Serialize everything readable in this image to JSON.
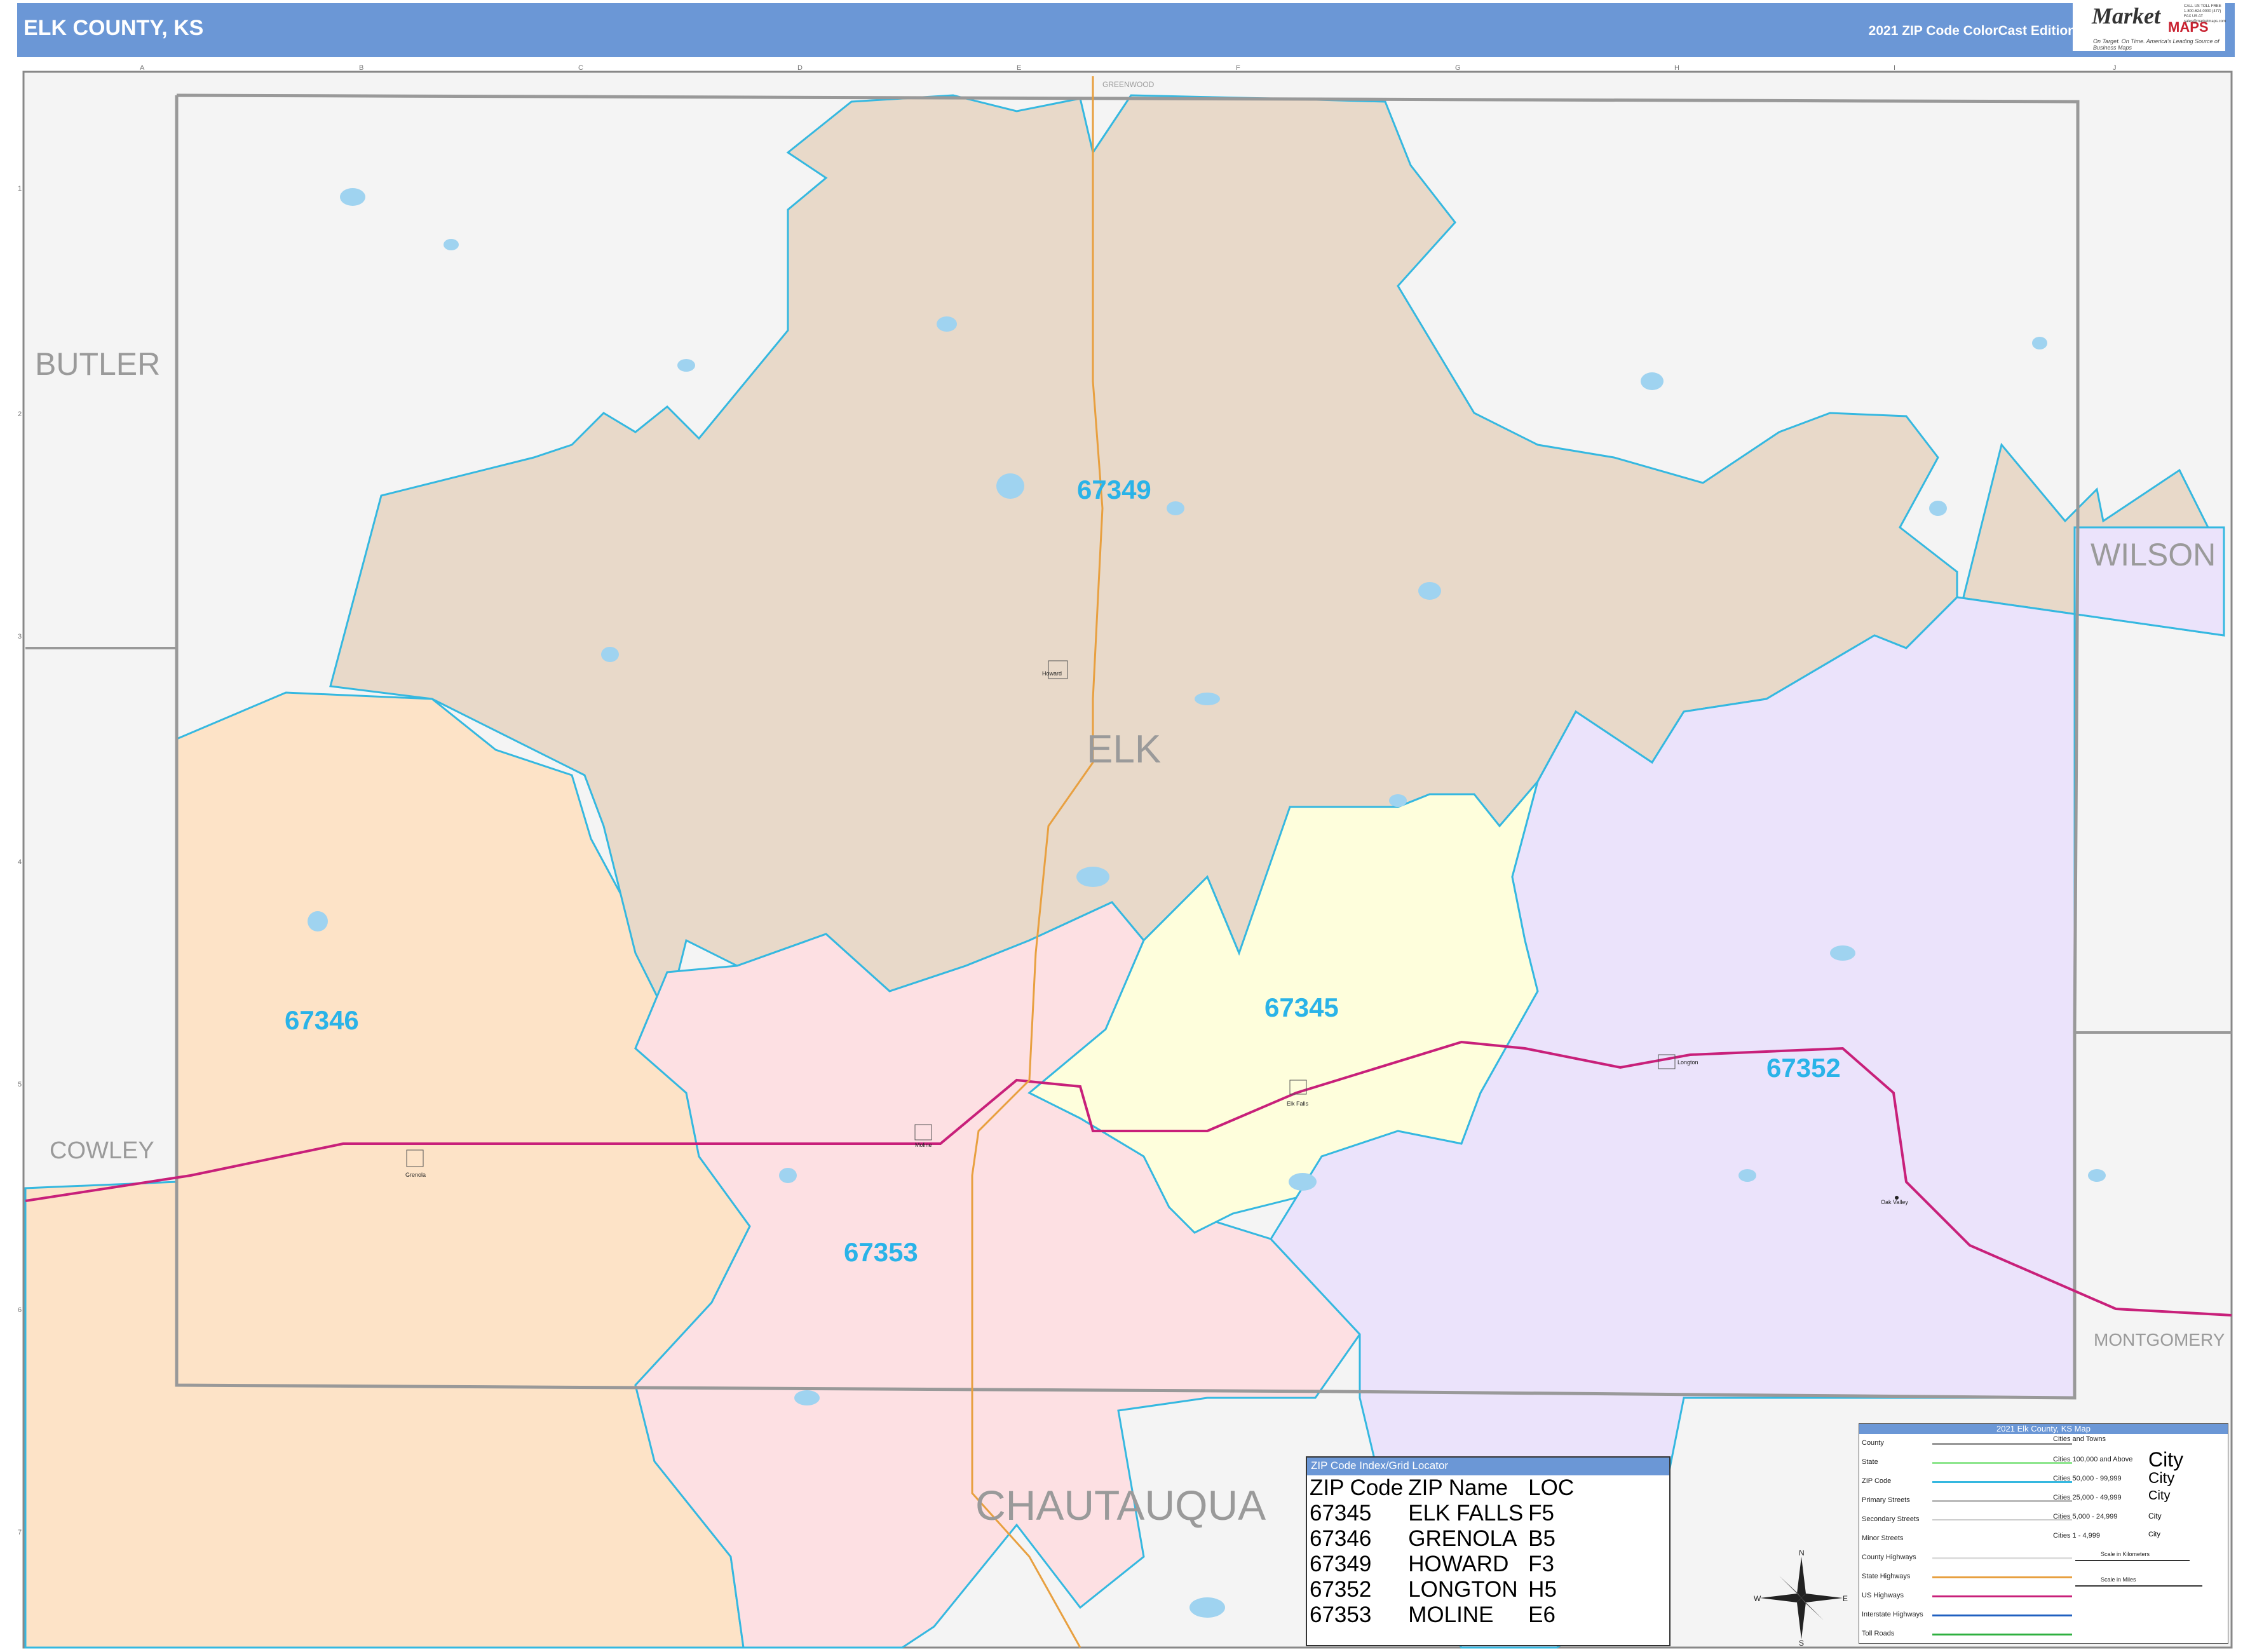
{
  "header": {
    "title": "ELK COUNTY, KS",
    "edition": "2021 ZIP Code ColorCast Edition"
  },
  "logo": {
    "main": "Market",
    "sub": "MAPS",
    "tagline": "On Target. On Time. America's Leading Source of Business Maps",
    "contact": "CALL US TOLL FREE 1-800-624-0000 (477) FAX US AT sales@marketmaps.com"
  },
  "grid": {
    "columns": [
      "A",
      "B",
      "C",
      "D",
      "E",
      "F",
      "G",
      "H",
      "I",
      "J"
    ],
    "rows": [
      "1",
      "2",
      "3",
      "4",
      "5",
      "6",
      "7"
    ]
  },
  "counties": {
    "butler": "BUTLER",
    "wilson": "WILSON",
    "cowley": "COWLEY",
    "montgomery": "MONTGOMERY",
    "chautauqua": "CHAUTAUQUA",
    "elk": "ELK",
    "greenwood": "GREENWOOD"
  },
  "zips": {
    "z67349": "67349",
    "z67346": "67346",
    "z67345": "67345",
    "z67352": "67352",
    "z67353": "67353"
  },
  "zip_colors": {
    "67349": "#e8d9c9",
    "67346": "#fde3c7",
    "67345": "#fefedc",
    "67352": "#ebe3fb",
    "67353": "#fde0e3"
  },
  "cities": {
    "howard": "Howard",
    "moline": "Moline",
    "grenola": "Grenola",
    "elk_falls": "Elk Falls",
    "longton": "Longton",
    "oak_valley": "Oak Valley"
  },
  "zip_index": {
    "title": "ZIP Code Index/Grid Locator",
    "headers": [
      "ZIP Code",
      "ZIP Name",
      "LOC"
    ],
    "rows": [
      [
        "67345",
        "ELK FALLS",
        "F5"
      ],
      [
        "67346",
        "GRENOLA",
        "B5"
      ],
      [
        "67349",
        "HOWARD",
        "F3"
      ],
      [
        "67352",
        "LONGTON",
        "H5"
      ],
      [
        "67353",
        "MOLINE",
        "E6"
      ]
    ]
  },
  "legend": {
    "title": "2021 Elk County, KS Map",
    "items": [
      "County",
      "State",
      "ZIP Code",
      "Primary Streets",
      "Secondary Streets",
      "Minor Streets",
      "County Highways",
      "State Highways",
      "US Highways",
      "Interstate Highways",
      "Toll Roads"
    ],
    "cities_title": "Cities and Towns",
    "city_tiers": [
      "Cities 100,000 and Above",
      "Cities 50,000 - 99,999",
      "Cities 25,000 - 49,999",
      "Cities 5,000 - 24,999",
      "Cities 1 - 4,999"
    ],
    "city_samples": [
      "City",
      "City",
      "City",
      "City",
      "City"
    ],
    "scale_km": "Scale in Kilometers",
    "scale_mi": "Scale in Miles"
  },
  "compass": {
    "n": "N",
    "s": "S",
    "e": "E",
    "w": "W"
  },
  "colors": {
    "header": "#6b97d6",
    "zip_border": "#35b8e0",
    "county_border": "#999999",
    "us_highway": "#c8207a",
    "state_highway": "#e8a040",
    "outside": "#f4f4f4",
    "water": "#9fd3f0"
  }
}
